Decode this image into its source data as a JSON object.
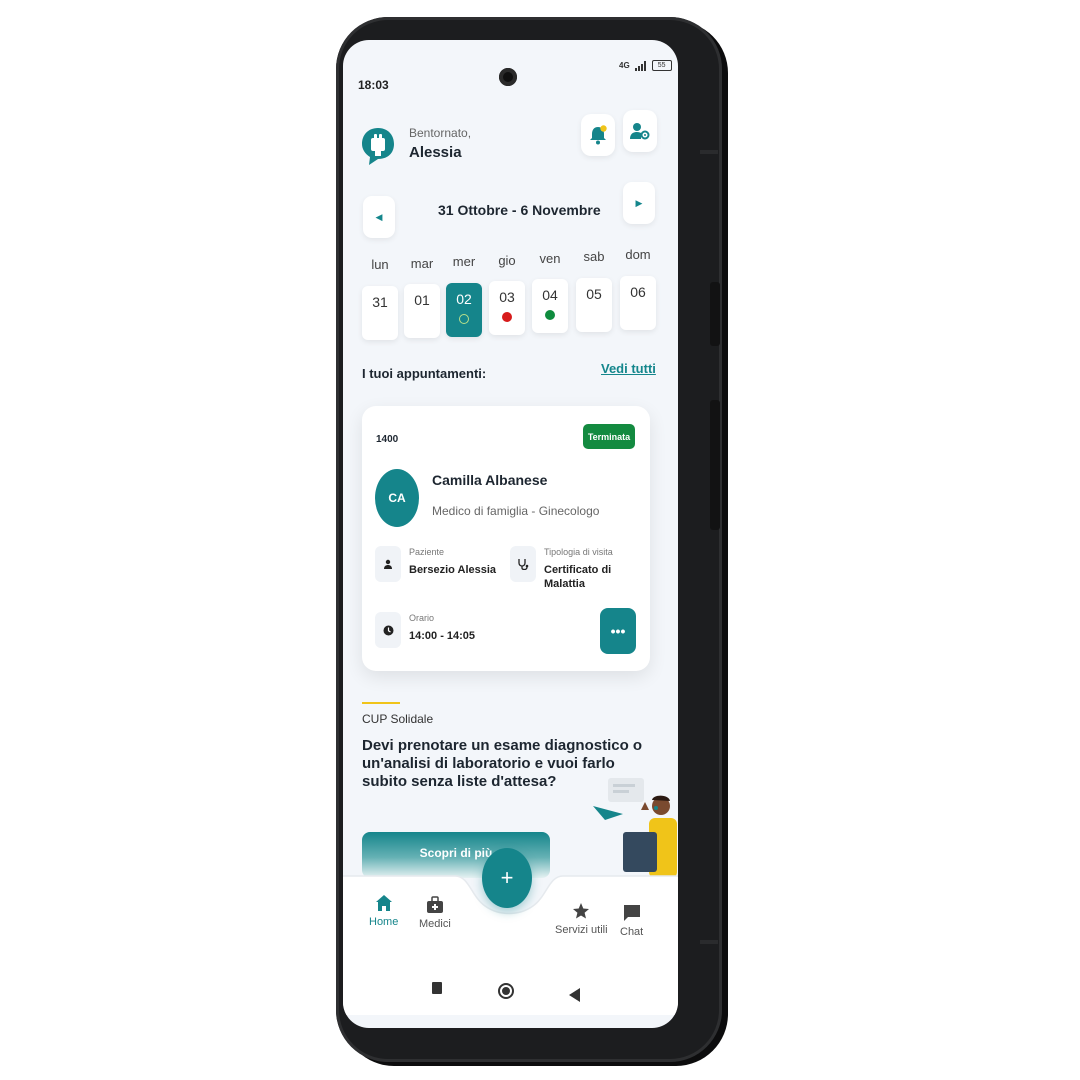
{
  "status_bar": {
    "time": "18:03",
    "network": "4G",
    "battery": "55"
  },
  "header": {
    "greeting": "Bentornato,",
    "user_name": "Alessia"
  },
  "calendar": {
    "week_range": "31 Ottobre - 6 Novembre",
    "days": [
      {
        "name": "lun",
        "num": "31",
        "selected": false,
        "dot": "none"
      },
      {
        "name": "mar",
        "num": "01",
        "selected": false,
        "dot": "none"
      },
      {
        "name": "mer",
        "num": "02",
        "selected": true,
        "dot": "ring"
      },
      {
        "name": "gio",
        "num": "03",
        "selected": false,
        "dot": "red"
      },
      {
        "name": "ven",
        "num": "04",
        "selected": false,
        "dot": "green"
      },
      {
        "name": "sab",
        "num": "05",
        "selected": false,
        "dot": "none"
      },
      {
        "name": "dom",
        "num": "06",
        "selected": false,
        "dot": "none"
      }
    ]
  },
  "appointments": {
    "title": "I tuoi appuntamenti:",
    "see_all": "Vedi tutti",
    "card": {
      "code": "1400",
      "status": "Terminata",
      "initials": "CA",
      "doctor_name": "Camilla Albanese",
      "specialty": "Medico di famiglia - Ginecologo",
      "patient_label": "Paziente",
      "patient_value": "Bersezio Alessia",
      "visit_label": "Tipologia di visita",
      "visit_value_line1": "Certificato di",
      "visit_value_line2": "Malattia",
      "time_label": "Orario",
      "time_value": "14:00 - 14:05",
      "more": "•••"
    }
  },
  "promo": {
    "label": "CUP Solidale",
    "text": "Devi prenotare un esame diagnostico o un'analisi di laboratorio e vuoi farlo subito senza liste d'attesa?",
    "cta": "Scopri di più"
  },
  "bottom_nav": {
    "fab": "+",
    "items": [
      {
        "label": "Home",
        "icon": "home-icon"
      },
      {
        "label": "Medici",
        "icon": "medical-bag-icon"
      },
      {
        "label": "Servizi utili",
        "icon": "star-icon"
      },
      {
        "label": "Chat",
        "icon": "chat-icon"
      }
    ]
  },
  "colors": {
    "primary": "#15858b",
    "success": "#138a40",
    "danger": "#d71b1b",
    "accent": "#f0c419"
  }
}
